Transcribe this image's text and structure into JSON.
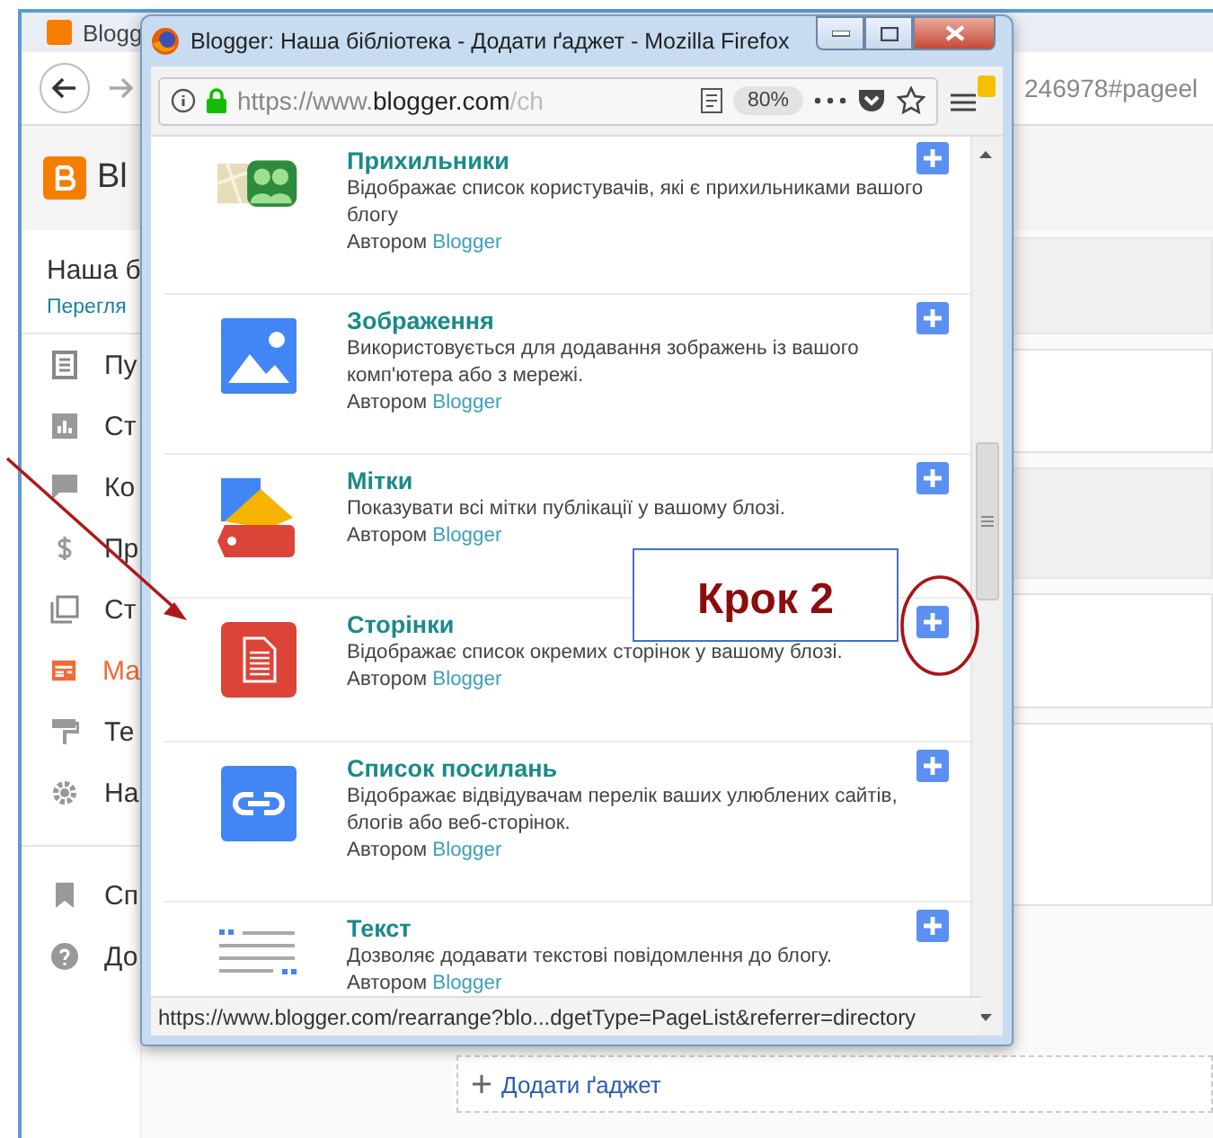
{
  "background_page": {
    "tab_title": "Blogg",
    "address_tail": "246978#pageel",
    "logo_text": "Bl",
    "blog_title": "Наша б",
    "view_link": "Перегля",
    "nav_items": [
      {
        "label": "Пу",
        "kind": "posts",
        "selected": false
      },
      {
        "label": "Ст",
        "kind": "stats",
        "selected": false
      },
      {
        "label": "Ко",
        "kind": "comments",
        "selected": false
      },
      {
        "label": "Пр",
        "kind": "earnings",
        "selected": false
      },
      {
        "label": "Ст",
        "kind": "pages",
        "selected": false
      },
      {
        "label": "Ма",
        "kind": "layout",
        "selected": true
      },
      {
        "label": "Те",
        "kind": "theme",
        "selected": false
      },
      {
        "label": "На",
        "kind": "settings",
        "selected": false
      }
    ],
    "extra_items": [
      {
        "label": "Сп",
        "kind": "bookmark"
      },
      {
        "label": "До",
        "kind": "help"
      }
    ],
    "add_gadget": "Додати ґаджет"
  },
  "window": {
    "title": "Blogger: Наша бібліотека - Додати ґаджет - Mozilla Firefox",
    "url_scheme": "https://www.",
    "url_domain": "blogger.com",
    "url_path": "/ch",
    "zoom": "80%",
    "gadgets": [
      {
        "kind": "followers",
        "title": "Прихильники",
        "description": "Відображає список користувачів, які є прихильниками вашого блогу",
        "author_prefix": "Автором",
        "author": "Blogger"
      },
      {
        "kind": "image",
        "title": "Зображення",
        "description": "Використовується для додавання зображень із вашого комп'ютера або з мережі.",
        "author_prefix": "Автором",
        "author": "Blogger"
      },
      {
        "kind": "labels",
        "title": "Мітки",
        "description": "Показувати всі мітки публікації у вашому блозі.",
        "author_prefix": "Автором",
        "author": "Blogger"
      },
      {
        "kind": "pages",
        "title": "Сторінки",
        "description": "Відображає список окремих сторінок у вашому блозі.",
        "author_prefix": "Автором",
        "author": "Blogger"
      },
      {
        "kind": "links",
        "title": "Список посилань",
        "description": "Відображає відвідувачам перелік ваших улюблених сайтів, блогів або веб-сторінок.",
        "author_prefix": "Автором",
        "author": "Blogger"
      },
      {
        "kind": "text",
        "title": "Текст",
        "description": "Дозволяє додавати текстові повідомлення до блогу.",
        "author_prefix": "Автором",
        "author": "Blogger"
      }
    ],
    "status_url": "https://www.blogger.com/rearrange?blo...dgetType=PageList&referrer=directory"
  },
  "annotation": {
    "label": "Крок 2"
  }
}
